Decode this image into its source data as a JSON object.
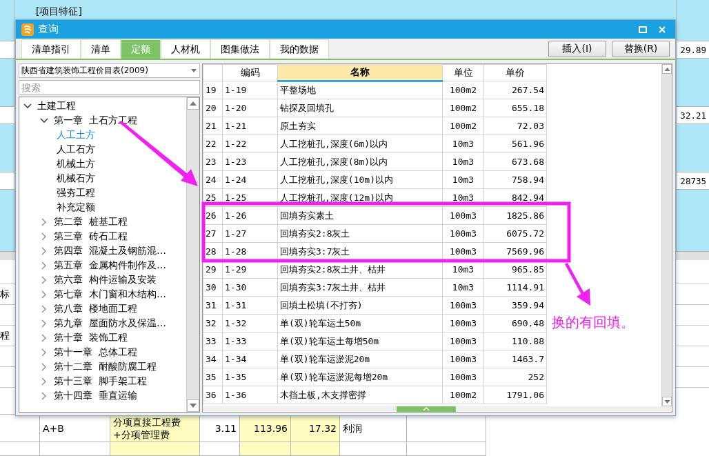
{
  "background": {
    "item_feature": "[项目特征]",
    "right_values": [
      "29.89",
      "32.21",
      "28735"
    ],
    "left_fragments": [
      "标",
      "程"
    ],
    "bottom_row": {
      "code": "A+B",
      "basis": "分项直接工程费\n+分项管理费",
      "rate": "3.11",
      "amount": "113.96",
      "total": "17.32",
      "name": "利润"
    }
  },
  "dialog": {
    "title": "查询",
    "tabs": [
      {
        "label": "清单指引",
        "selected": false
      },
      {
        "label": "清单",
        "selected": false
      },
      {
        "label": "定额",
        "selected": true
      },
      {
        "label": "人材机",
        "selected": false
      },
      {
        "label": "图集做法",
        "selected": false
      },
      {
        "label": "我的数据",
        "selected": false
      }
    ],
    "buttons": [
      "插入(I)",
      "替换(R)"
    ],
    "library": "陕西省建筑装饰工程价目表(2009)",
    "search": {
      "placeholder": "搜索"
    },
    "tree": [
      {
        "label": "土建工程",
        "expanded": true,
        "children": [
          {
            "label": "第一章  土石方工程",
            "expanded": true,
            "children": [
              {
                "label": "人工土方",
                "selected": true
              },
              {
                "label": "人工石方",
                "selected": false
              },
              {
                "label": "机械土方",
                "selected": false
              },
              {
                "label": "机械石方",
                "selected": false
              },
              {
                "label": "强夯工程",
                "selected": false
              },
              {
                "label": "补充定额",
                "selected": false
              }
            ]
          },
          {
            "label": "第二章  桩基工程",
            "expanded": false
          },
          {
            "label": "第三章  砖石工程",
            "expanded": false
          },
          {
            "label": "第四章  混凝土及钢筋混…",
            "expanded": false
          },
          {
            "label": "第五章  金属构件制作及…",
            "expanded": false
          },
          {
            "label": "第六章  构件运输及安装",
            "expanded": false
          },
          {
            "label": "第七章  木门窗和木结构…",
            "expanded": false
          },
          {
            "label": "第八章  楼地面工程",
            "expanded": false
          },
          {
            "label": "第九章  屋面防水及保温…",
            "expanded": false
          },
          {
            "label": "第十章  装饰工程",
            "expanded": false
          },
          {
            "label": "第十一章  总体工程",
            "expanded": false
          },
          {
            "label": "第十二章  耐酸防腐工程",
            "expanded": false
          },
          {
            "label": "第十三章  脚手架工程",
            "expanded": false
          },
          {
            "label": "第十四章  垂直运输",
            "expanded": false
          }
        ]
      }
    ],
    "columns": [
      {
        "label": "编码",
        "selected": false
      },
      {
        "label": "名称",
        "selected": true
      },
      {
        "label": "单位",
        "selected": false
      },
      {
        "label": "单价",
        "selected": false
      }
    ],
    "rows": [
      {
        "no": "19",
        "code": "1-19",
        "name": "平整场地",
        "unit": "100m2",
        "price": "267.54"
      },
      {
        "no": "20",
        "code": "1-20",
        "name": "钻探及回填孔",
        "unit": "100m2",
        "price": "655.18"
      },
      {
        "no": "21",
        "code": "1-21",
        "name": "原土夯实",
        "unit": "100m2",
        "price": "72.03"
      },
      {
        "no": "22",
        "code": "1-22",
        "name": "人工挖桩孔,深度(6m)以内",
        "unit": "10m3",
        "price": "561.96"
      },
      {
        "no": "23",
        "code": "1-23",
        "name": "人工挖桩孔,深度(8m)以内",
        "unit": "10m3",
        "price": "673.68"
      },
      {
        "no": "24",
        "code": "1-24",
        "name": "人工挖桩孔,深度(10m)以内",
        "unit": "10m3",
        "price": "758.94"
      },
      {
        "no": "25",
        "code": "1-25",
        "name": "人工挖桩孔,深度(12m)以内",
        "unit": "10m3",
        "price": "842.94"
      },
      {
        "no": "26",
        "code": "1-26",
        "name": "回填夯实素土",
        "unit": "100m3",
        "price": "1825.86"
      },
      {
        "no": "27",
        "code": "1-27",
        "name": "回填夯实2:8灰土",
        "unit": "100m3",
        "price": "6075.72"
      },
      {
        "no": "28",
        "code": "1-28",
        "name": "回填夯实3:7灰土",
        "unit": "100m3",
        "price": "7569.96"
      },
      {
        "no": "29",
        "code": "1-29",
        "name": "回填夯实2:8灰土井、枯井",
        "unit": "10m3",
        "price": "965.85"
      },
      {
        "no": "30",
        "code": "1-30",
        "name": "回填夯实3:7灰土井、枯井",
        "unit": "10m3",
        "price": "1114.91"
      },
      {
        "no": "31",
        "code": "1-31",
        "name": "回填土松填(不打夯)",
        "unit": "100m3",
        "price": "359.94"
      },
      {
        "no": "32",
        "code": "1-32",
        "name": "单(双)轮车运土50m",
        "unit": "100m3",
        "price": "690.48"
      },
      {
        "no": "33",
        "code": "1-33",
        "name": "单(双)轮车运土每增50m",
        "unit": "100m3",
        "price": "110.88"
      },
      {
        "no": "34",
        "code": "1-34",
        "name": "单(双)轮车运淤泥20m",
        "unit": "100m3",
        "price": "1463.7"
      },
      {
        "no": "35",
        "code": "1-35",
        "name": "单(双)轮车运淤泥每增20m",
        "unit": "100m3",
        "price": "252"
      },
      {
        "no": "36",
        "code": "1-36",
        "name": "木挡土板,木支撑密撑",
        "unit": "100m2",
        "price": "1791.06"
      }
    ]
  },
  "annotation": {
    "note": "换的有回填。"
  }
}
